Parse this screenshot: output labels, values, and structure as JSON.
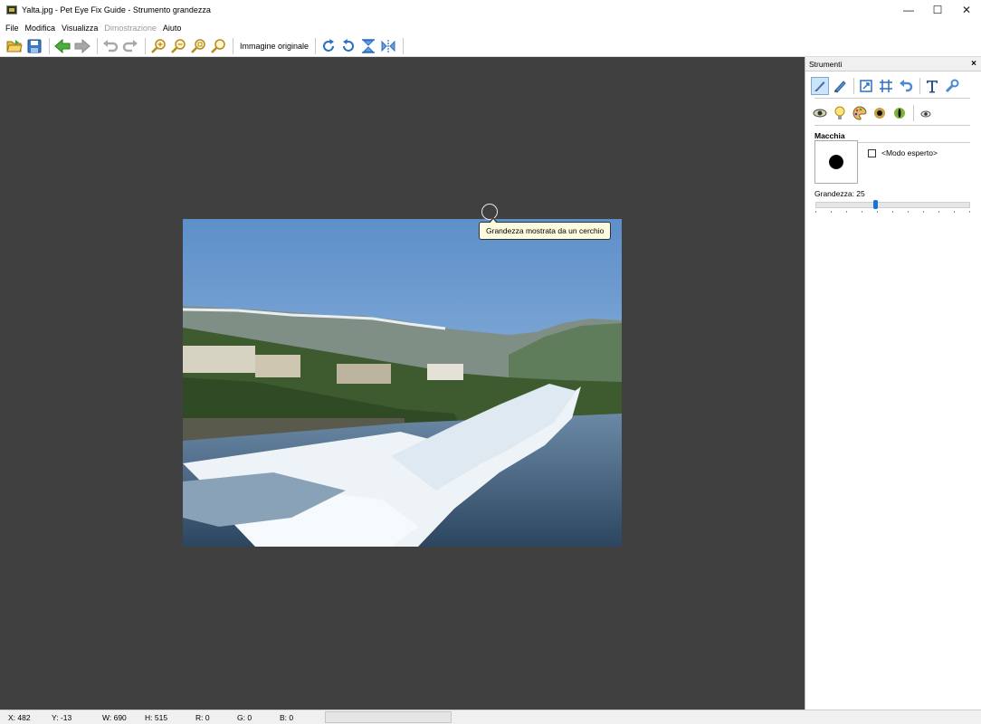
{
  "window": {
    "title": "Yalta.jpg - Pet Eye Fix Guide - Strumento grandezza",
    "minimize": "—",
    "maximize": "☐",
    "close": "✕"
  },
  "menu": {
    "items": [
      "File",
      "Modifica",
      "Visualizza",
      "Dimostrazione",
      "Aiuto"
    ]
  },
  "toolbar": {
    "original_image_label": "Immagine originale"
  },
  "canvas": {
    "tooltip": "Grandezza mostrata da un cerchio"
  },
  "panel": {
    "title": "Strumenti",
    "close": "×",
    "section_title": "Macchia",
    "expert_mode_label": "<Modo esperto>",
    "expert_mode_checked": false,
    "size_label": "Grandezza: 25",
    "size_value": 25
  },
  "status": {
    "x": "X: 482",
    "y": "Y: -13",
    "w": "W: 690",
    "h": "H: 515",
    "r": "R: 0",
    "g": "G: 0",
    "b": "B: 0"
  },
  "colors": {
    "canvas_bg": "#404040",
    "accent": "#1a73d6",
    "tooltip_bg": "#fffbe0"
  }
}
